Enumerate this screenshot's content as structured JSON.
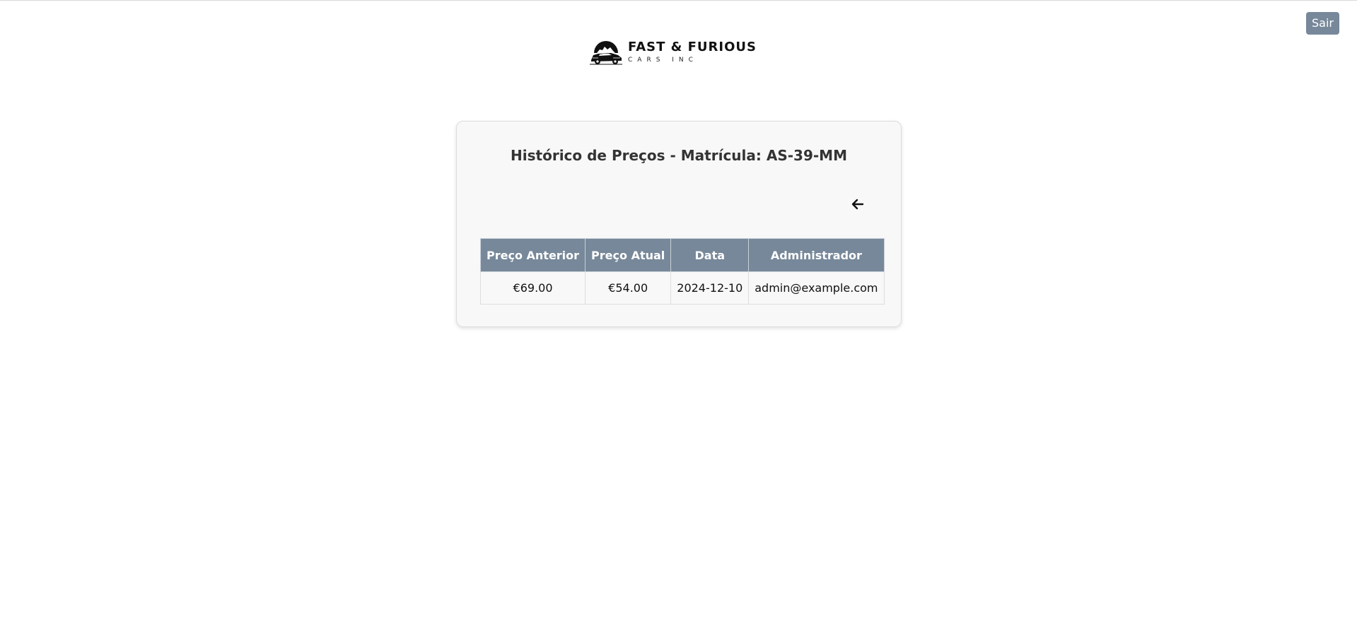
{
  "header": {
    "logo": {
      "name": "FAST & FURIOUS",
      "subtitle": "CARS INC"
    },
    "logout_label": "Sair"
  },
  "card": {
    "title": "Histórico de Preços - Matrícula: AS-39-MM",
    "back_icon": "arrow-left-icon"
  },
  "table": {
    "headers": [
      "Preço Anterior",
      "Preço Atual",
      "Data",
      "Administrador"
    ],
    "rows": [
      [
        "€69.00",
        "€54.00",
        "2024-12-10",
        "admin@example.com"
      ]
    ]
  },
  "colors": {
    "accent": "#77889a",
    "card_background": "#f8f8f8"
  }
}
